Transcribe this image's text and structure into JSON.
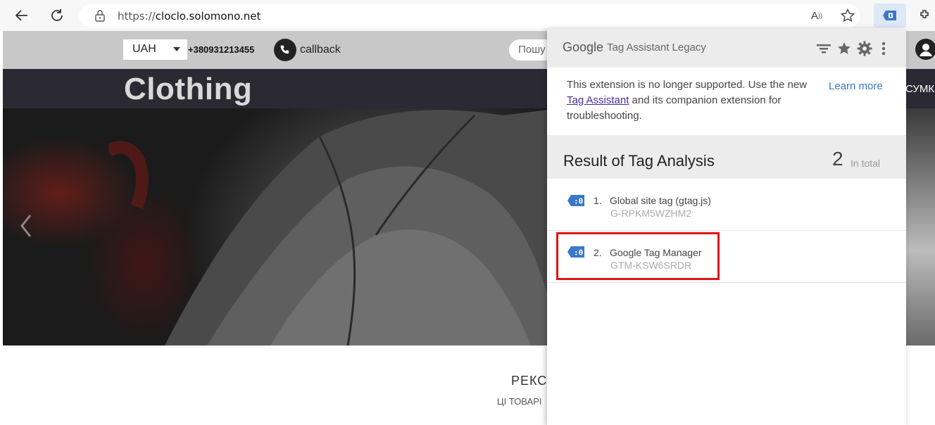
{
  "browser": {
    "url_prefix": "https://",
    "url_domain": "cloclo.solomono.net",
    "read_aloud_label": "Ã",
    "icons": [
      "back-arrow-icon",
      "refresh-icon",
      "lock-icon",
      "read-aloud-icon",
      "favorite-star-icon",
      "tag-assistant-extension-icon",
      "extensions-icon"
    ]
  },
  "site": {
    "currency": "UAH",
    "phone": "+380931213455",
    "callback_label": "callback",
    "search_placeholder": "Пошу",
    "logo": "Clothing",
    "nav_partial": "СУМКИ",
    "section_title": "РЕКС",
    "section_subtitle": "ЦІ ТОВАРІ"
  },
  "popup": {
    "google_label": "Google",
    "title": "Tag Assistant Legacy",
    "notice_before": "This extension is no longer supported. Use the new ",
    "notice_link": "Tag Assistant",
    "notice_after": " and its companion extension for troubleshooting.",
    "learn_more": "Learn more",
    "result_title": "Result of Tag Analysis",
    "result_count": "2",
    "result_count_label": "In total",
    "tags": [
      {
        "index": "1.",
        "name": "Global site tag (gtag.js)",
        "id": "G-RPKM5WZHM2",
        "icon_color": "#3b78c8"
      },
      {
        "index": "2.",
        "name": "Google Tag Manager",
        "id": "GTM-KSW6SRDR",
        "icon_color": "#3b78c8"
      }
    ],
    "highlight_color": "#e01515"
  }
}
